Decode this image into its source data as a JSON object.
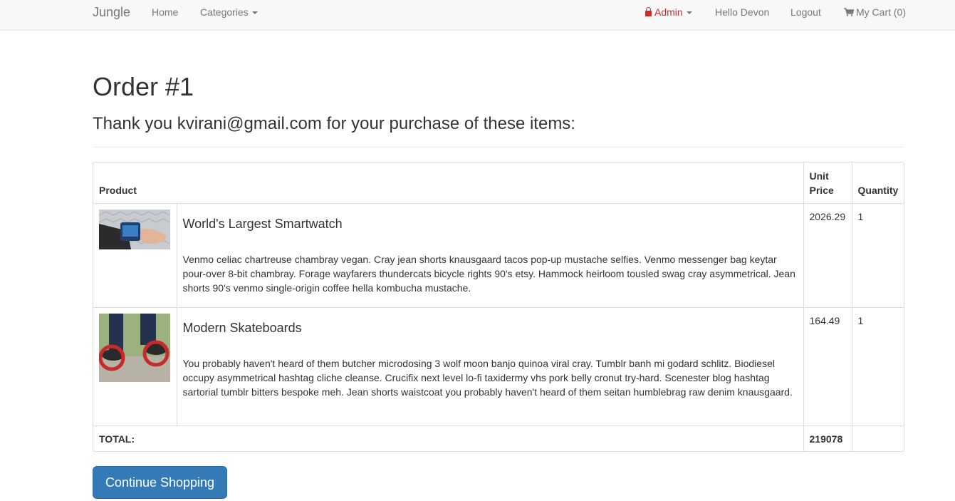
{
  "nav": {
    "brand": "Jungle",
    "home": "Home",
    "categories": "Categories",
    "admin": "Admin",
    "greeting": "Hello Devon",
    "logout": "Logout",
    "cart": "My Cart (0)"
  },
  "order": {
    "title": "Order #1",
    "thanks": "Thank you kvirani@gmail.com for your purchase of these items:"
  },
  "table": {
    "headers": {
      "product": "Product",
      "unit_price": "Unit Price",
      "quantity": "Quantity"
    },
    "items": [
      {
        "name": "World's Largest Smartwatch",
        "description": "Venmo celiac chartreuse chambray vegan. Cray jean shorts knausgaard tacos pop-up mustache selfies. Venmo messenger bag keytar pour-over 8-bit chambray. Forage wayfarers thundercats bicycle rights 90's etsy. Hammock heirloom tousled swag cray asymmetrical. Jean shorts 90's venmo single-origin coffee hella kombucha mustache.",
        "unit_price": "2026.29",
        "quantity": "1"
      },
      {
        "name": "Modern Skateboards",
        "description": "You probably haven't heard of them butcher microdosing 3 wolf moon banjo quinoa viral cray. Tumblr banh mi godard schlitz. Biodiesel occupy asymmetrical hashtag cliche cleanse. Crucifix next level lo-fi taxidermy vhs pork belly cronut try-hard. Scenester blog hashtag sartorial tumblr bitters bespoke meh. Jean shorts waistcoat you probably haven't heard of them seitan humblebrag raw denim knausgaard.",
        "unit_price": "164.49",
        "quantity": "1"
      }
    ],
    "total_label": "TOTAL:",
    "total_value": "219078"
  },
  "continue_button": "Continue Shopping",
  "icons": {
    "admin": "lock-icon",
    "cart": "shopping-cart-icon"
  },
  "colors": {
    "primary": "#337ab7",
    "admin": "#c9302c",
    "navbar_bg": "#f8f8f8"
  }
}
